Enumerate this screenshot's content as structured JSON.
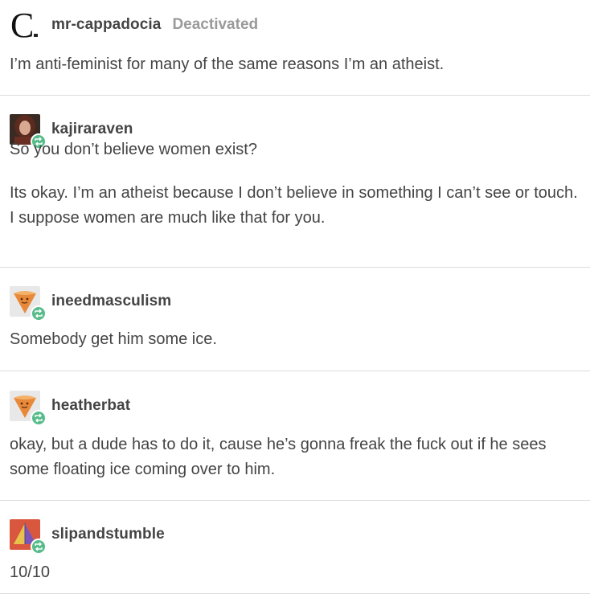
{
  "posts": [
    {
      "username": "mr-cappadocia",
      "status": "Deactivated",
      "avatar": "letter-c-icon",
      "avatar_letter": "C",
      "reblog": false,
      "paragraphs": [
        "I’m anti-feminist for many of the same reasons I’m an atheist."
      ]
    },
    {
      "username": "kajiraraven",
      "avatar": "photo-avatar",
      "reblog": true,
      "paragraphs": [
        "So you don’t believe women exist?",
        "Its okay. I’m an atheist because I don’t believe in something I can’t see or touch. I suppose women are much like that for you."
      ]
    },
    {
      "username": "ineedmasculism",
      "avatar": "ice-cream-cone-icon",
      "reblog": true,
      "paragraphs": [
        "Somebody get him some ice."
      ]
    },
    {
      "username": "heatherbat",
      "avatar": "ice-cream-cone-icon",
      "reblog": true,
      "paragraphs": [
        "okay, but a dude has to do it, cause he’s gonna freak the fuck out if he sees some floating ice coming over to him."
      ]
    },
    {
      "username": "slipandstumble",
      "avatar": "pyramid-icon",
      "reblog": true,
      "paragraphs": [
        "10/10"
      ]
    }
  ],
  "colors": {
    "reblog_badge": "#56bc8a",
    "text": "#444444",
    "status": "#9a9a9a",
    "divider": "#dcdcdc"
  }
}
